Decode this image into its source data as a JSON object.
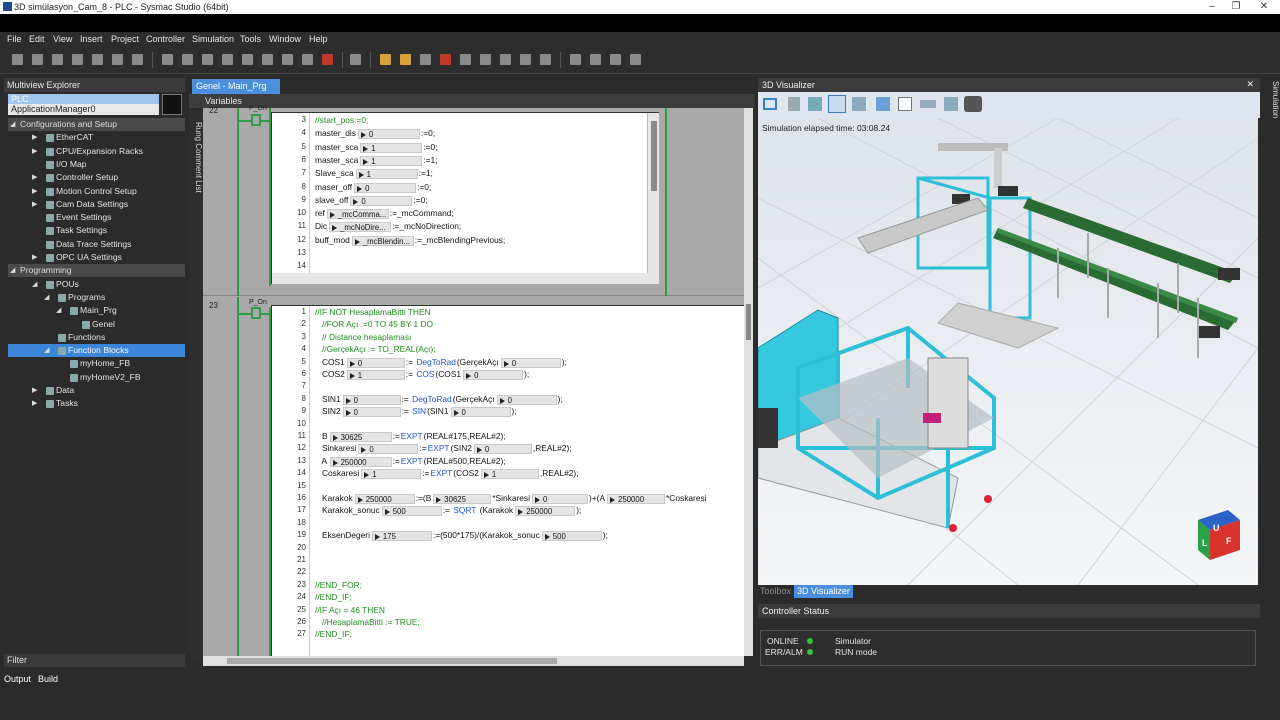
{
  "window": {
    "title": "3D simülasyon_Cam_8 - PLC - Sysmac Studio (64bit)",
    "min": "–",
    "max": "❐",
    "close": "✕"
  },
  "menu": [
    "File",
    "Edit",
    "View",
    "Insert",
    "Project",
    "Controller",
    "Simulation",
    "Tools",
    "Window",
    "Help"
  ],
  "left": {
    "title": "Multiview Explorer",
    "controller": "PLC",
    "app": "ApplicationManager0",
    "tree": [
      {
        "label": "Configurations and Setup",
        "x": 0,
        "sec": true,
        "ex": "◢"
      },
      {
        "label": "EtherCAT",
        "x": 26,
        "ex": "▶"
      },
      {
        "label": "CPU/Expansion Racks",
        "x": 26,
        "ex": "▶"
      },
      {
        "label": "I/O Map",
        "x": 26
      },
      {
        "label": "Controller Setup",
        "x": 26,
        "ex": "▶"
      },
      {
        "label": "Motion Control Setup",
        "x": 26,
        "ex": "▶"
      },
      {
        "label": "Cam Data Settings",
        "x": 26,
        "ex": "▶"
      },
      {
        "label": "Event Settings",
        "x": 26
      },
      {
        "label": "Task Settings",
        "x": 26
      },
      {
        "label": "Data Trace Settings",
        "x": 26
      },
      {
        "label": "OPC UA Settings",
        "x": 26,
        "ex": "▶"
      },
      {
        "label": "Programming",
        "x": 0,
        "sec": true,
        "ex": "◢"
      },
      {
        "label": "POUs",
        "x": 26,
        "ex": "◢"
      },
      {
        "label": "Programs",
        "x": 38,
        "ex": "◢"
      },
      {
        "label": "Main_Prg",
        "x": 50,
        "ex": "◢"
      },
      {
        "label": "Genel",
        "x": 62
      },
      {
        "label": "Functions",
        "x": 38
      },
      {
        "label": "Function Blocks",
        "x": 38,
        "sel": true,
        "ex": "◢"
      },
      {
        "label": "myHome_FB",
        "x": 50
      },
      {
        "label": "myHomeV2_FB",
        "x": 50
      },
      {
        "label": "Data",
        "x": 26,
        "ex": "▶"
      },
      {
        "label": "Tasks",
        "x": 26,
        "ex": "▶"
      }
    ],
    "filter": "Filter"
  },
  "center": {
    "tab": "Genel - Main_Prg",
    "variables": "Variables",
    "side_label": "Rung Comment List",
    "rung22": {
      "number": "22",
      "pon": "P_On",
      "lines": [
        {
          "n": "3",
          "parts": [
            {
              "t": "//start_pos:=0;",
              "c": "cm"
            }
          ]
        },
        {
          "n": "4",
          "parts": [
            {
              "t": "master_dis"
            },
            {
              "box": "0",
              "w": 62
            },
            {
              "t": ":=0;"
            }
          ]
        },
        {
          "n": "5",
          "parts": [
            {
              "t": "master_sca"
            },
            {
              "box": "1",
              "w": 62
            },
            {
              "t": ":=0;"
            }
          ]
        },
        {
          "n": "6",
          "parts": [
            {
              "t": "master_sca"
            },
            {
              "box": "1",
              "w": 62
            },
            {
              "t": ":=1;"
            }
          ]
        },
        {
          "n": "7",
          "parts": [
            {
              "t": "Slave_sca"
            },
            {
              "box": "1",
              "w": 62
            },
            {
              "t": ":=1;"
            }
          ]
        },
        {
          "n": "8",
          "parts": [
            {
              "t": "maser_off"
            },
            {
              "box": "0",
              "w": 62
            },
            {
              "t": ":=0;"
            }
          ]
        },
        {
          "n": "9",
          "parts": [
            {
              "t": "slave_off"
            },
            {
              "box": "0",
              "w": 62
            },
            {
              "t": ":=0;"
            }
          ]
        },
        {
          "n": "10",
          "parts": [
            {
              "t": "ref"
            },
            {
              "box": "_mcComma...",
              "w": 62
            },
            {
              "t": ":=_mcCommand;"
            }
          ]
        },
        {
          "n": "11",
          "parts": [
            {
              "t": "Dic"
            },
            {
              "box": "_mcNoDire...",
              "w": 62
            },
            {
              "t": ":=_mcNoDirection;"
            }
          ]
        },
        {
          "n": "12",
          "parts": [
            {
              "t": "buff_mod"
            },
            {
              "box": "_mcBlendin...",
              "w": 62
            },
            {
              "t": ":=_mcBlendingPrevious;"
            }
          ]
        },
        {
          "n": "13",
          "parts": []
        },
        {
          "n": "14",
          "parts": []
        },
        {
          "n": "15",
          "parts": []
        }
      ]
    },
    "rung23": {
      "number": "23",
      "pon": "P_On",
      "lines": [
        {
          "n": "1",
          "parts": [
            {
              "t": "//IF NOT HesaplamaBitti THEN",
              "c": "cm"
            }
          ]
        },
        {
          "n": "2",
          "parts": [
            {
              "t": "   //FOR Açı :=0 TO 45 BY 1 DO",
              "c": "cm"
            }
          ]
        },
        {
          "n": "3",
          "parts": [
            {
              "t": "   // Distance hesaplaması",
              "c": "cm"
            }
          ]
        },
        {
          "n": "4",
          "parts": [
            {
              "t": "   //GerçekAçı := TO_REAL(Açı);",
              "c": "cm"
            }
          ]
        },
        {
          "n": "5",
          "parts": [
            {
              "t": "   COS1"
            },
            {
              "box": "0",
              "w": 58
            },
            {
              "t": ":= "
            },
            {
              "t": "DegToRad",
              "c": "kw"
            },
            {
              "t": "(GerçekAçı"
            },
            {
              "box": "0",
              "w": 60
            },
            {
              "t": ");"
            }
          ]
        },
        {
          "n": "6",
          "parts": [
            {
              "t": "   COS2"
            },
            {
              "box": "1",
              "w": 58
            },
            {
              "t": ":= "
            },
            {
              "t": "COS",
              "c": "kw"
            },
            {
              "t": "(COS1"
            },
            {
              "box": "0",
              "w": 60
            },
            {
              "t": ");"
            }
          ]
        },
        {
          "n": "7",
          "parts": []
        },
        {
          "n": "8",
          "parts": [
            {
              "t": "   SIN1"
            },
            {
              "box": "0",
              "w": 58
            },
            {
              "t": ":= "
            },
            {
              "t": "DegToRad",
              "c": "kw"
            },
            {
              "t": "(GerçekAçı"
            },
            {
              "box": "0",
              "w": 60
            },
            {
              "t": ");"
            }
          ]
        },
        {
          "n": "9",
          "parts": [
            {
              "t": "   SIN2"
            },
            {
              "box": "0",
              "w": 58
            },
            {
              "t": ":= "
            },
            {
              "t": "SIN",
              "c": "kw"
            },
            {
              "t": "(SIN1"
            },
            {
              "box": "0",
              "w": 60
            },
            {
              "t": ");"
            }
          ]
        },
        {
          "n": "10",
          "parts": []
        },
        {
          "n": "11",
          "parts": [
            {
              "t": "   B"
            },
            {
              "box": "30625",
              "w": 62
            },
            {
              "t": ":="
            },
            {
              "t": "EXPT",
              "c": "kw"
            },
            {
              "t": "(REAL#175,REAL#2);"
            }
          ]
        },
        {
          "n": "12",
          "parts": [
            {
              "t": "   Sinkaresi"
            },
            {
              "box": "0",
              "w": 60
            },
            {
              "t": ":="
            },
            {
              "t": "EXPT",
              "c": "kw"
            },
            {
              "t": "(SIN2"
            },
            {
              "box": "0",
              "w": 58
            },
            {
              "t": ",REAL#2);"
            }
          ]
        },
        {
          "n": "13",
          "parts": [
            {
              "t": "   A"
            },
            {
              "box": "250000",
              "w": 62
            },
            {
              "t": ":="
            },
            {
              "t": "EXPT",
              "c": "kw"
            },
            {
              "t": "(REAL#500,REAL#2);"
            }
          ]
        },
        {
          "n": "14",
          "parts": [
            {
              "t": "   Coskaresi"
            },
            {
              "box": "1",
              "w": 60
            },
            {
              "t": ":="
            },
            {
              "t": "EXPT",
              "c": "kw"
            },
            {
              "t": "(COS2"
            },
            {
              "box": "1",
              "w": 58
            },
            {
              "t": ",REAL#2);"
            }
          ]
        },
        {
          "n": "15",
          "parts": []
        },
        {
          "n": "16",
          "parts": [
            {
              "t": "   Karakok"
            },
            {
              "box": "250000",
              "w": 60
            },
            {
              "t": ":=(B"
            },
            {
              "box": "30625",
              "w": 58
            },
            {
              "t": "*Sinkaresi"
            },
            {
              "box": "0",
              "w": 56
            },
            {
              "t": ")+(A"
            },
            {
              "box": "250000",
              "w": 58
            },
            {
              "t": "*Coskaresi"
            }
          ]
        },
        {
          "n": "17",
          "parts": [
            {
              "t": "   Karakok_sonuc"
            },
            {
              "box": "500",
              "w": 60
            },
            {
              "t": ":= "
            },
            {
              "t": "SQRT",
              "c": "kw"
            },
            {
              "t": " (Karakok"
            },
            {
              "box": "250000",
              "w": 60
            },
            {
              "t": ");"
            }
          ]
        },
        {
          "n": "18",
          "parts": []
        },
        {
          "n": "19",
          "parts": [
            {
              "t": "   EksenDegeri"
            },
            {
              "box": "175",
              "w": 60
            },
            {
              "t": ":=(500*175)/(Karakok_sonuc"
            },
            {
              "box": "500",
              "w": 60
            },
            {
              "t": ");"
            }
          ]
        },
        {
          "n": "20",
          "parts": []
        },
        {
          "n": "21",
          "parts": []
        },
        {
          "n": "22",
          "parts": []
        },
        {
          "n": "23",
          "parts": [
            {
              "t": "//END_FOR;",
              "c": "cm"
            }
          ]
        },
        {
          "n": "24",
          "parts": [
            {
              "t": "//END_IF;",
              "c": "cm"
            }
          ]
        },
        {
          "n": "25",
          "parts": [
            {
              "t": "//IF Açı = 46 THEN",
              "c": "cm"
            }
          ]
        },
        {
          "n": "26",
          "parts": [
            {
              "t": "   //HesaplamaBitti := TRUE;",
              "c": "cm"
            }
          ]
        },
        {
          "n": "27",
          "parts": [
            {
              "t": "//END_IF;",
              "c": "cm"
            }
          ]
        }
      ]
    }
  },
  "visualizer": {
    "title": "3D Visualizer",
    "elapsed": "Simulation elapsed time: 03:08.24",
    "tabs": {
      "toolbox": "Toolbox",
      "visualizer": "3D Visualizer"
    },
    "cube": {
      "top": "U",
      "left": "L",
      "right": "F"
    }
  },
  "controller_status": {
    "title": "Controller Status",
    "rows": [
      {
        "label": "ONLINE",
        "value": "Simulator"
      },
      {
        "label": "ERR/ALM",
        "value": "RUN mode"
      }
    ]
  },
  "simulation_side": "Simulation",
  "bottom": {
    "output": "Output",
    "build": "Build"
  }
}
